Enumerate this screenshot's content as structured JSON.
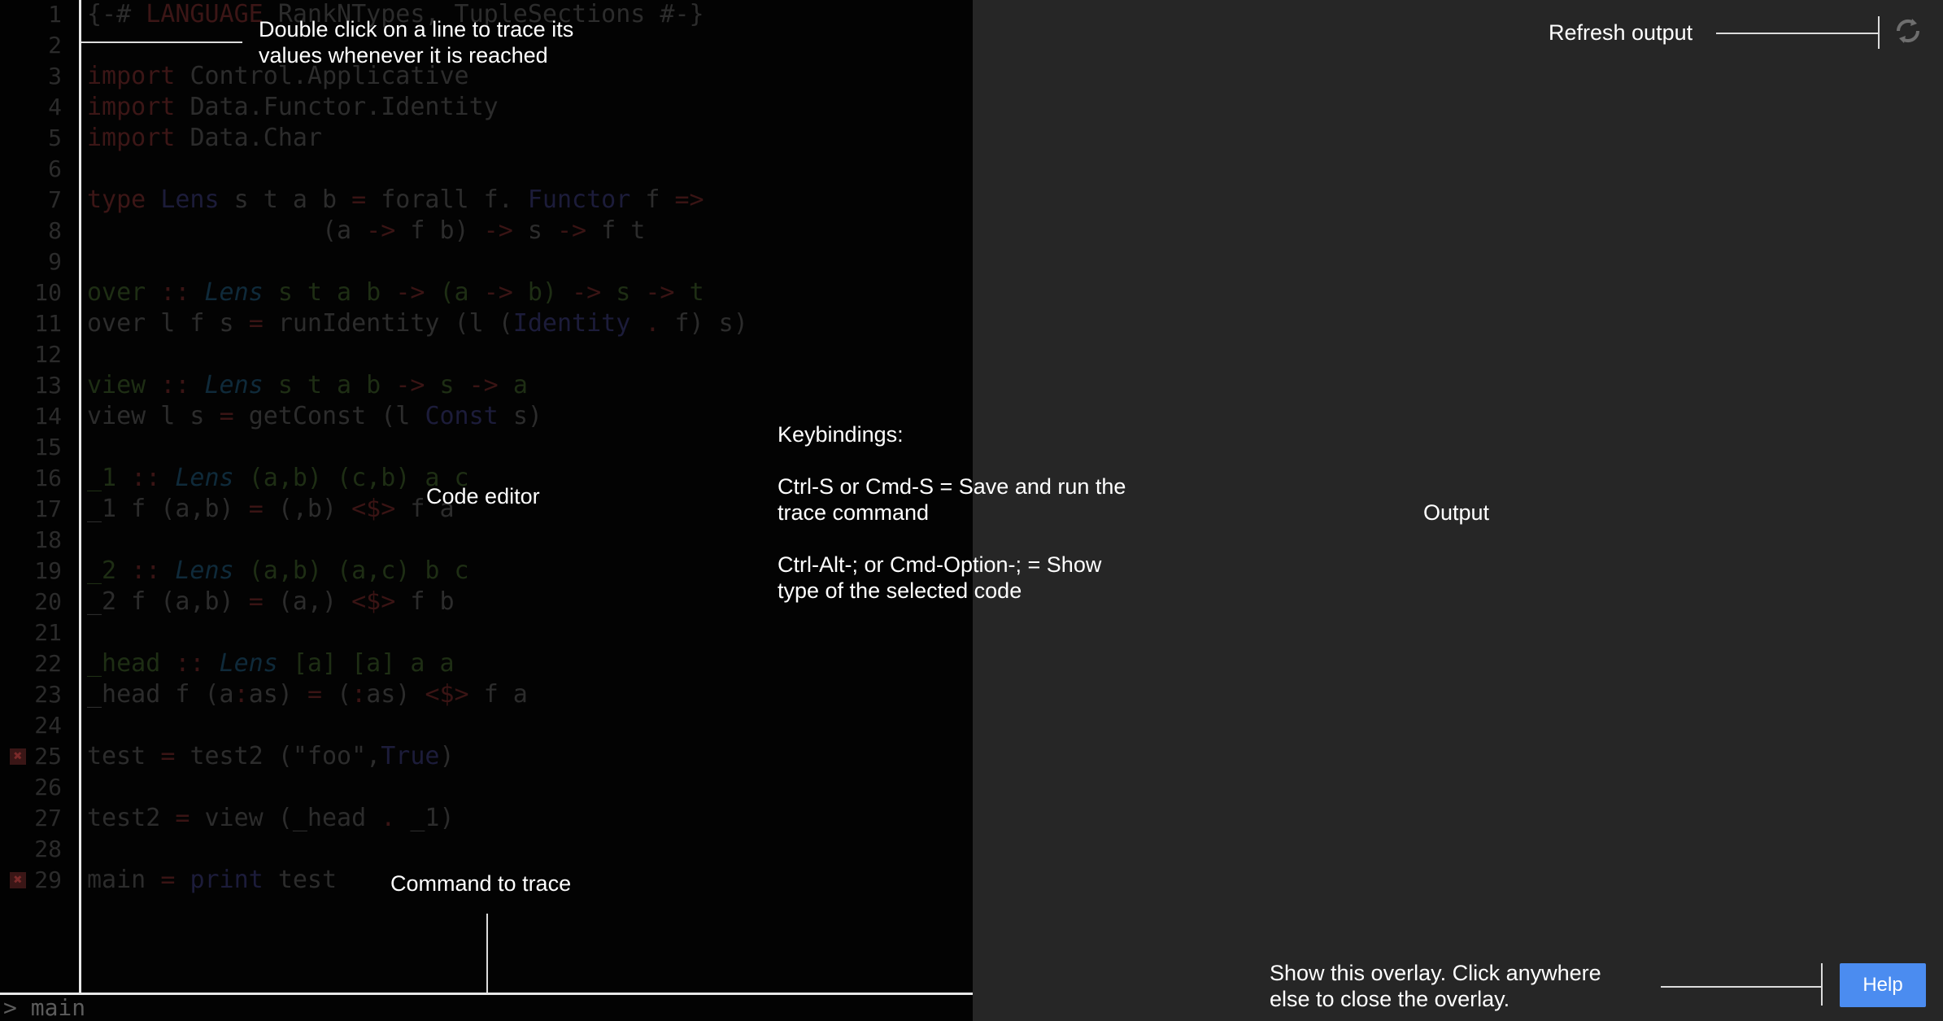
{
  "editor": {
    "label": "Code editor",
    "lines": [
      {
        "n": "1",
        "segs": [
          [
            "st",
            "{-# "
          ],
          [
            "kw",
            "LANGUAGE "
          ],
          [
            "st",
            "RankNTypes, TupleSections #-}"
          ]
        ]
      },
      {
        "n": "2",
        "segs": []
      },
      {
        "n": "3",
        "segs": [
          [
            "kw",
            "import "
          ],
          [
            "st",
            "Control.Applicative"
          ]
        ]
      },
      {
        "n": "4",
        "segs": [
          [
            "kw",
            "import "
          ],
          [
            "st",
            "Data.Functor.Identity"
          ]
        ]
      },
      {
        "n": "5",
        "segs": [
          [
            "kw",
            "import "
          ],
          [
            "st",
            "Data.Char"
          ]
        ]
      },
      {
        "n": "6",
        "segs": []
      },
      {
        "n": "7",
        "segs": [
          [
            "kw",
            "type "
          ],
          [
            "ty",
            "Lens "
          ],
          [
            "st",
            "s t a b "
          ],
          [
            "op",
            "= "
          ],
          [
            "st",
            "forall f. "
          ],
          [
            "ty",
            "Functor "
          ],
          [
            "st",
            "f "
          ],
          [
            "op",
            "=>"
          ]
        ]
      },
      {
        "n": "8",
        "segs": [
          [
            "st",
            "                (a "
          ],
          [
            "op",
            "-> "
          ],
          [
            "st",
            "f b) "
          ],
          [
            "op",
            "-> "
          ],
          [
            "st",
            "s "
          ],
          [
            "op",
            "-> "
          ],
          [
            "st",
            "f t"
          ]
        ]
      },
      {
        "n": "9",
        "segs": []
      },
      {
        "n": "10",
        "segs": [
          [
            "sg",
            "over "
          ],
          [
            "op",
            ":: "
          ],
          [
            "it",
            "Lens "
          ],
          [
            "sg",
            "s t a b "
          ],
          [
            "op",
            "-> "
          ],
          [
            "sg",
            "(a "
          ],
          [
            "op",
            "-> "
          ],
          [
            "sg",
            "b) "
          ],
          [
            "op",
            "-> "
          ],
          [
            "sg",
            "s "
          ],
          [
            "op",
            "-> "
          ],
          [
            "sg",
            "t"
          ]
        ]
      },
      {
        "n": "11",
        "segs": [
          [
            "st",
            "over l f s "
          ],
          [
            "op",
            "= "
          ],
          [
            "st",
            "runIdentity (l ("
          ],
          [
            "ty",
            "Identity "
          ],
          [
            "op",
            ". "
          ],
          [
            "st",
            "f) s)"
          ]
        ]
      },
      {
        "n": "12",
        "segs": []
      },
      {
        "n": "13",
        "segs": [
          [
            "sg",
            "view "
          ],
          [
            "op",
            ":: "
          ],
          [
            "it",
            "Lens "
          ],
          [
            "sg",
            "s t a b "
          ],
          [
            "op",
            "-> "
          ],
          [
            "sg",
            "s "
          ],
          [
            "op",
            "-> "
          ],
          [
            "sg",
            "a"
          ]
        ]
      },
      {
        "n": "14",
        "segs": [
          [
            "st",
            "view l s "
          ],
          [
            "op",
            "= "
          ],
          [
            "st",
            "getConst (l "
          ],
          [
            "ty",
            "Const "
          ],
          [
            "st",
            "s)"
          ]
        ]
      },
      {
        "n": "15",
        "segs": []
      },
      {
        "n": "16",
        "segs": [
          [
            "sg",
            "_1 "
          ],
          [
            "op",
            ":: "
          ],
          [
            "it",
            "Lens "
          ],
          [
            "sg",
            "(a,b) (c,b) a c"
          ]
        ]
      },
      {
        "n": "17",
        "segs": [
          [
            "st",
            "_1 f (a,b) "
          ],
          [
            "op",
            "= "
          ],
          [
            "st",
            "(,b) "
          ],
          [
            "op",
            "<$> "
          ],
          [
            "st",
            "f a"
          ]
        ]
      },
      {
        "n": "18",
        "segs": []
      },
      {
        "n": "19",
        "segs": [
          [
            "sg",
            "_2 "
          ],
          [
            "op",
            ":: "
          ],
          [
            "it",
            "Lens "
          ],
          [
            "sg",
            "(a,b) (a,c) b c"
          ]
        ]
      },
      {
        "n": "20",
        "segs": [
          [
            "st",
            "_2 f (a,b) "
          ],
          [
            "op",
            "= "
          ],
          [
            "st",
            "(a,) "
          ],
          [
            "op",
            "<$> "
          ],
          [
            "st",
            "f b"
          ]
        ]
      },
      {
        "n": "21",
        "segs": []
      },
      {
        "n": "22",
        "segs": [
          [
            "sg",
            "_head "
          ],
          [
            "op",
            ":: "
          ],
          [
            "it",
            "Lens "
          ],
          [
            "sg",
            "[a] [a] a a"
          ]
        ]
      },
      {
        "n": "23",
        "segs": [
          [
            "st",
            "_head f (a"
          ],
          [
            "op",
            ":"
          ],
          [
            "st",
            "as) "
          ],
          [
            "op",
            "= "
          ],
          [
            "st",
            "("
          ],
          [
            "op",
            ":"
          ],
          [
            "st",
            "as) "
          ],
          [
            "op",
            "<$> "
          ],
          [
            "st",
            "f a"
          ]
        ]
      },
      {
        "n": "24",
        "segs": []
      },
      {
        "n": "25",
        "err": true,
        "segs": [
          [
            "st",
            "test "
          ],
          [
            "op",
            "= "
          ],
          [
            "st",
            "test2 (\"foo\","
          ],
          [
            "ty",
            "True"
          ],
          [
            "st",
            ")"
          ]
        ]
      },
      {
        "n": "26",
        "segs": []
      },
      {
        "n": "27",
        "segs": [
          [
            "st",
            "test2 "
          ],
          [
            "op",
            "= "
          ],
          [
            "st",
            "view (_head "
          ],
          [
            "op",
            ". "
          ],
          [
            "st",
            "_1)"
          ]
        ]
      },
      {
        "n": "28",
        "segs": []
      },
      {
        "n": "29",
        "err": true,
        "segs": [
          [
            "st",
            "main "
          ],
          [
            "op",
            "= "
          ],
          [
            "ty",
            "print "
          ],
          [
            "st",
            "test"
          ]
        ]
      }
    ]
  },
  "command": {
    "prompt": "> main",
    "label": "Command to trace"
  },
  "output": {
    "label": "Output",
    "refresh_label": "Refresh output"
  },
  "overlay": {
    "trace_hint_line1": "Double click on a line to trace its",
    "trace_hint_line2": "values whenever it is reached",
    "keybindings_title": "Keybindings:",
    "kb1_line1": "Ctrl-S or Cmd-S = Save and run the",
    "kb1_line2": "trace command",
    "kb2_line1": "Ctrl-Alt-; or Cmd-Option-; = Show",
    "kb2_line2": "type of the selected code",
    "help_hint_line1": "Show this overlay. Click anywhere",
    "help_hint_line2": "else to close the overlay.",
    "help_button": "Help"
  },
  "icons": {
    "refresh": "refresh-icon",
    "error": "error-marker-icon"
  },
  "colors": {
    "help_button": "#4b8cf0",
    "output_bg": "#262626",
    "editor_bg": "#030303"
  }
}
